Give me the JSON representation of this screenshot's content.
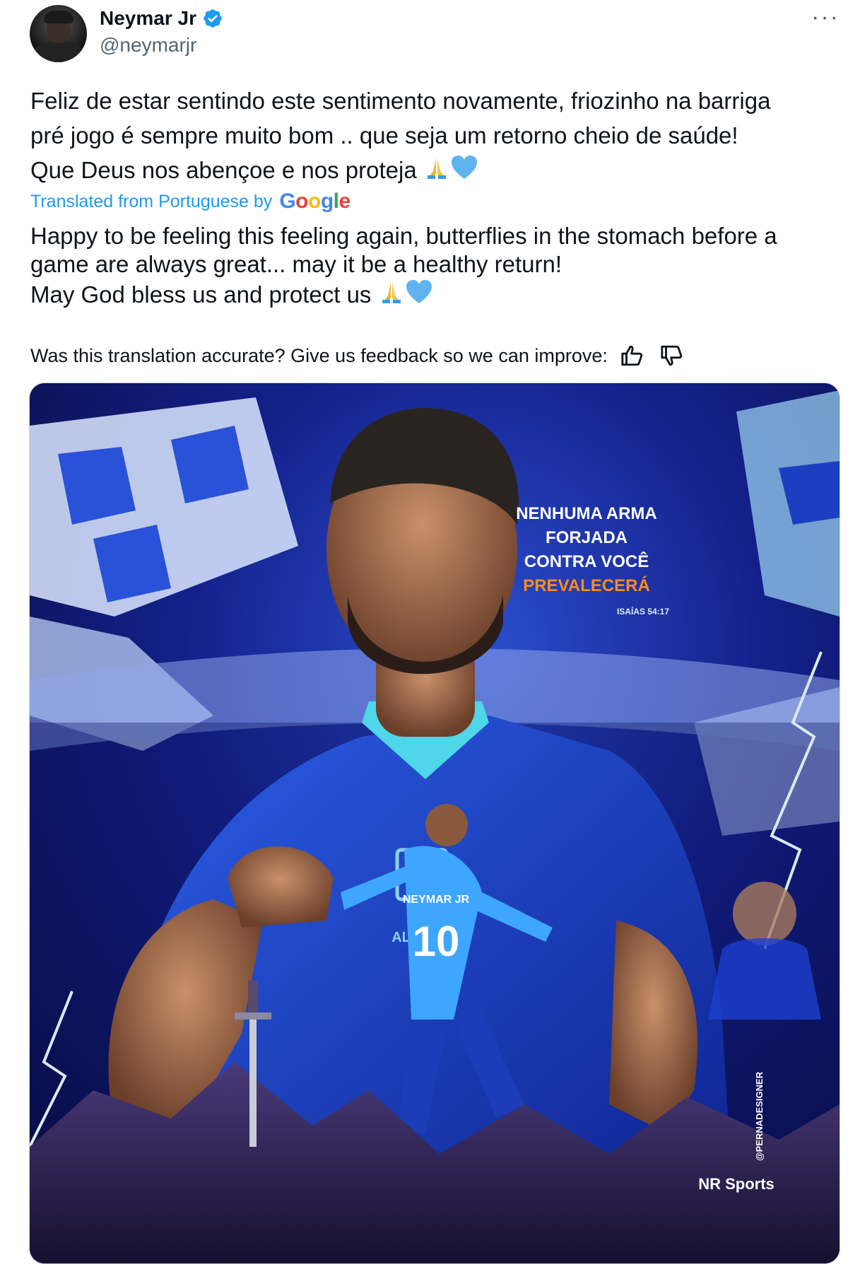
{
  "author": {
    "name": "Neymar Jr",
    "handle": "@neymarjr",
    "verified_color": "#1d9bf0"
  },
  "tweet": {
    "lines": [
      "Feliz de estar sentindo este sentimento novamente, friozinho na barriga",
      "pré jogo é sempre muito bom .. que seja um retorno cheio de saúde!",
      "Que Deus nos abençoe e nos proteja"
    ]
  },
  "translation": {
    "label": "Translated from Portuguese by",
    "provider": "Google",
    "lines": [
      "Happy to be feeling this feeling again, butterflies in the stomach before a",
      "game are always great... may it be a healthy return!",
      "May God bless us and protect us"
    ],
    "feedback": "Was this translation accurate? Give us feedback so we can improve:"
  },
  "media": {
    "quote_lines": [
      "NENHUMA ARMA",
      "FORJADA",
      "CONTRA VOCÊ"
    ],
    "quote_highlight": "PREVALECERÁ",
    "reference": "ISAÍAS 54:17",
    "credit": "NR Sports",
    "designer": "@PERNADESIGNER",
    "jersey_name": "NEYMAR JR",
    "jersey_number": "10",
    "club_text": "ALHILAL",
    "highlight_color": "#ff8c1a"
  },
  "icons": {
    "more": "more-icon",
    "verified": "verified-badge-icon",
    "thumbs_up": "thumbs-up-icon",
    "thumbs_down": "thumbs-down-icon"
  }
}
